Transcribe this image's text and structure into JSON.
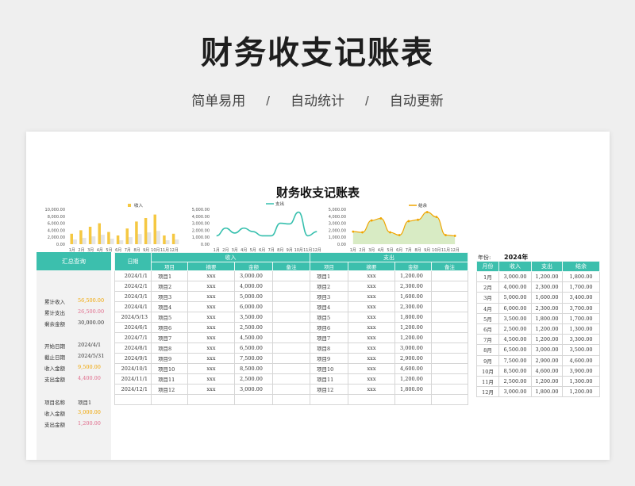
{
  "header": {
    "title": "财务收支记账表",
    "tags": [
      "简单易用",
      "自动统计",
      "自动更新"
    ],
    "separator": "/"
  },
  "sheet_title": "财务收支记账表",
  "colors": {
    "accent": "#3cbfad",
    "income_bar": "#f5c842",
    "line_expense": "#35bfad",
    "line_balance": "#f0a500",
    "area_balance": "#d8ebc4"
  },
  "chart_data": [
    {
      "type": "bar",
      "legend": "收入",
      "categories": [
        "1月",
        "2月",
        "3月",
        "4月",
        "5月",
        "6月",
        "7月",
        "8月",
        "9月",
        "10月",
        "11月",
        "12月"
      ],
      "values": [
        3000,
        4000,
        5000,
        6000,
        3500,
        2500,
        4500,
        6500,
        7500,
        8500,
        2500,
        3000
      ],
      "yticks": [
        "10,000.00",
        "8,000.00",
        "6,000.00",
        "4,000.00",
        "2,000.00",
        "0.00"
      ],
      "ylim": [
        0,
        10000
      ]
    },
    {
      "type": "line",
      "legend": "支出",
      "categories": [
        "1月",
        "2月",
        "3月",
        "4月",
        "5月",
        "6月",
        "7月",
        "8月",
        "9月",
        "10月",
        "11月",
        "12月"
      ],
      "values": [
        1200,
        2300,
        1600,
        2300,
        1800,
        1200,
        1200,
        3000,
        2900,
        4600,
        1200,
        1800
      ],
      "yticks": [
        "5,000.00",
        "4,000.00",
        "3,000.00",
        "2,000.00",
        "1,000.00",
        "0.00"
      ],
      "ylim": [
        0,
        5000
      ]
    },
    {
      "type": "area",
      "legend": "结余",
      "categories": [
        "1月",
        "2月",
        "3月",
        "4月",
        "5月",
        "6月",
        "7月",
        "8月",
        "9月",
        "10月",
        "11月",
        "12月"
      ],
      "values": [
        1800,
        1700,
        3400,
        3700,
        1700,
        1300,
        3300,
        3500,
        4600,
        3900,
        1300,
        1200
      ],
      "yticks": [
        "5,000.00",
        "4,000.00",
        "3,000.00",
        "2,000.00",
        "1,000.00",
        "0.00"
      ],
      "ylim": [
        0,
        5000
      ]
    }
  ],
  "summary": {
    "header": "汇总查询",
    "rows": [
      {
        "label": "累计收入",
        "value": "56,500.00",
        "color": "#f0a500"
      },
      {
        "label": "累计支出",
        "value": "26,500.00",
        "color": "#e06a8a"
      },
      {
        "label": "剩余金额",
        "value": "30,000.00",
        "color": "#333333"
      },
      {
        "label": "",
        "value": "",
        "color": "#333333"
      },
      {
        "label": "开始日期",
        "value": "2024/4/1",
        "color": "#333333"
      },
      {
        "label": "截止日期",
        "value": "2024/5/31",
        "color": "#333333"
      },
      {
        "label": "收入金额",
        "value": "9,500.00",
        "color": "#f0a500"
      },
      {
        "label": "支出金额",
        "value": "4,400.00",
        "color": "#e06a8a"
      },
      {
        "label": "",
        "value": "",
        "color": "#333333"
      },
      {
        "label": "项目名称",
        "value": "项目1",
        "color": "#333333"
      },
      {
        "label": "收入金额",
        "value": "3,000.00",
        "color": "#f0a500"
      },
      {
        "label": "支出金额",
        "value": "1,200.00",
        "color": "#e06a8a"
      }
    ]
  },
  "ledger": {
    "headers": {
      "date": "日期",
      "income": "收入",
      "expense": "支出",
      "sub": [
        "项目",
        "摘要",
        "金额",
        "备注",
        "项目",
        "摘要",
        "金额",
        "备注"
      ]
    },
    "rows": [
      [
        "2024/1/1",
        "项目1",
        "xxx",
        "3,000.00",
        "",
        "项目1",
        "xxx",
        "1,200.00",
        ""
      ],
      [
        "2024/2/1",
        "项目2",
        "xxx",
        "4,000.00",
        "",
        "项目2",
        "xxx",
        "2,300.00",
        ""
      ],
      [
        "2024/3/1",
        "项目3",
        "xxx",
        "5,000.00",
        "",
        "项目3",
        "xxx",
        "1,600.00",
        ""
      ],
      [
        "2024/4/1",
        "项目4",
        "xxx",
        "6,000.00",
        "",
        "项目4",
        "xxx",
        "2,300.00",
        ""
      ],
      [
        "2024/5/13",
        "项目5",
        "xxx",
        "3,500.00",
        "",
        "项目5",
        "xxx",
        "1,800.00",
        ""
      ],
      [
        "2024/6/1",
        "项目6",
        "xxx",
        "2,500.00",
        "",
        "项目6",
        "xxx",
        "1,200.00",
        ""
      ],
      [
        "2024/7/1",
        "项目7",
        "xxx",
        "4,500.00",
        "",
        "项目7",
        "xxx",
        "1,200.00",
        ""
      ],
      [
        "2024/8/1",
        "项目8",
        "xxx",
        "6,500.00",
        "",
        "项目8",
        "xxx",
        "3,000.00",
        ""
      ],
      [
        "2024/9/1",
        "项目9",
        "xxx",
        "7,500.00",
        "",
        "项目9",
        "xxx",
        "2,900.00",
        ""
      ],
      [
        "2024/10/1",
        "项目10",
        "xxx",
        "8,500.00",
        "",
        "项目10",
        "xxx",
        "4,600.00",
        ""
      ],
      [
        "2024/11/1",
        "项目11",
        "xxx",
        "2,500.00",
        "",
        "项目11",
        "xxx",
        "1,200.00",
        ""
      ],
      [
        "2024/12/1",
        "项目12",
        "xxx",
        "3,000.00",
        "",
        "项目12",
        "xxx",
        "1,800.00",
        ""
      ],
      [
        "",
        "",
        "",
        "",
        "",
        "",
        "",
        "",
        ""
      ]
    ]
  },
  "monthly": {
    "year_label": "年份:",
    "year": "2024年",
    "headers": [
      "月份",
      "收入",
      "支出",
      "结余"
    ],
    "rows": [
      [
        "1月",
        "3,000.00",
        "1,200.00",
        "1,800.00"
      ],
      [
        "2月",
        "4,000.00",
        "2,300.00",
        "1,700.00"
      ],
      [
        "3月",
        "5,000.00",
        "1,600.00",
        "3,400.00"
      ],
      [
        "4月",
        "6,000.00",
        "2,300.00",
        "3,700.00"
      ],
      [
        "5月",
        "3,500.00",
        "1,800.00",
        "1,700.00"
      ],
      [
        "6月",
        "2,500.00",
        "1,200.00",
        "1,300.00"
      ],
      [
        "7月",
        "4,500.00",
        "1,200.00",
        "3,300.00"
      ],
      [
        "8月",
        "6,500.00",
        "3,000.00",
        "3,500.00"
      ],
      [
        "9月",
        "7,500.00",
        "2,900.00",
        "4,600.00"
      ],
      [
        "10月",
        "8,500.00",
        "4,600.00",
        "3,900.00"
      ],
      [
        "11月",
        "2,500.00",
        "1,200.00",
        "1,300.00"
      ],
      [
        "12月",
        "3,000.00",
        "1,800.00",
        "1,200.00"
      ]
    ]
  }
}
